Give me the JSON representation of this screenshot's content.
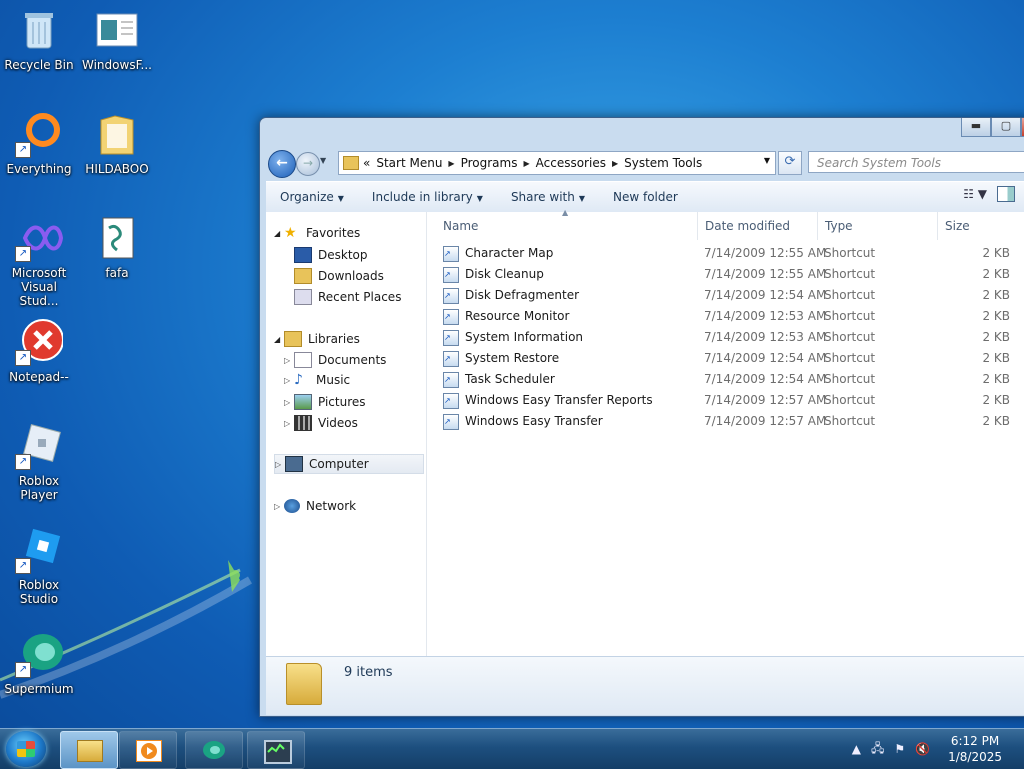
{
  "desktop": {
    "icons": [
      {
        "label": "Recycle Bin"
      },
      {
        "label": "WindowsF..."
      },
      {
        "label": "Everything"
      },
      {
        "label": "HILDABOO"
      },
      {
        "label": "Microsoft Visual Stud..."
      },
      {
        "label": "fafa"
      },
      {
        "label": "Notepad--"
      },
      {
        "label": "Roblox Player"
      },
      {
        "label": "Roblox Studio"
      },
      {
        "label": "Supermium"
      }
    ]
  },
  "explorer": {
    "address": {
      "overflow": "«",
      "crumbs": [
        "Start Menu",
        "Programs",
        "Accessories",
        "System Tools"
      ]
    },
    "search": {
      "placeholder": "Search System Tools"
    },
    "toolbar": {
      "organize": "Organize",
      "include_in_library": "Include in library",
      "share_with": "Share with",
      "new_folder": "New folder"
    },
    "nav": {
      "favorites": "Favorites",
      "desktop": "Desktop",
      "downloads": "Downloads",
      "recent_places": "Recent Places",
      "libraries": "Libraries",
      "documents": "Documents",
      "music": "Music",
      "pictures": "Pictures",
      "videos": "Videos",
      "computer": "Computer",
      "network": "Network"
    },
    "columns": {
      "name": "Name",
      "date": "Date modified",
      "type": "Type",
      "size": "Size"
    },
    "files": [
      {
        "name": "Character Map",
        "date": "7/14/2009 12:55 AM",
        "type": "Shortcut",
        "size": "2 KB"
      },
      {
        "name": "Disk Cleanup",
        "date": "7/14/2009 12:55 AM",
        "type": "Shortcut",
        "size": "2 KB"
      },
      {
        "name": "Disk Defragmenter",
        "date": "7/14/2009 12:54 AM",
        "type": "Shortcut",
        "size": "2 KB"
      },
      {
        "name": "Resource Monitor",
        "date": "7/14/2009 12:53 AM",
        "type": "Shortcut",
        "size": "2 KB"
      },
      {
        "name": "System Information",
        "date": "7/14/2009 12:53 AM",
        "type": "Shortcut",
        "size": "2 KB"
      },
      {
        "name": "System Restore",
        "date": "7/14/2009 12:54 AM",
        "type": "Shortcut",
        "size": "2 KB"
      },
      {
        "name": "Task Scheduler",
        "date": "7/14/2009 12:54 AM",
        "type": "Shortcut",
        "size": "2 KB"
      },
      {
        "name": "Windows Easy Transfer Reports",
        "date": "7/14/2009 12:57 AM",
        "type": "Shortcut",
        "size": "2 KB"
      },
      {
        "name": "Windows Easy Transfer",
        "date": "7/14/2009 12:57 AM",
        "type": "Shortcut",
        "size": "2 KB"
      }
    ],
    "details": {
      "item_count": "9 items"
    }
  },
  "taskbar": {
    "clock": {
      "time": "6:12 PM",
      "date": "1/8/2025"
    }
  }
}
